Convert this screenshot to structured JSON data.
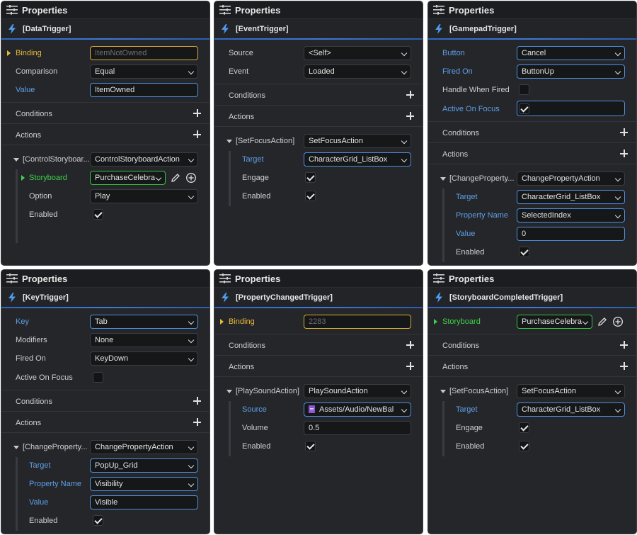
{
  "panel_title": "Properties",
  "panels": [
    {
      "header": "[DataTrigger]",
      "binding_label": "Binding",
      "binding_placeholder": "ItemNotOwned",
      "comparison_label": "Comparison",
      "comparison_value": "Equal",
      "value_label": "Value",
      "value_value": "ItemOwned",
      "conditions_label": "Conditions",
      "actions_label": "Actions",
      "action_name": "[ControlStoryboar...",
      "action_type": "ControlStoryboardAction",
      "storyboard_label": "Storyboard",
      "storyboard_value": "PurchaseCelebra",
      "option_label": "Option",
      "option_value": "Play",
      "enabled_label": "Enabled"
    },
    {
      "header": "[EventTrigger]",
      "source_label": "Source",
      "source_value": "<Self>",
      "event_label": "Event",
      "event_value": "Loaded",
      "conditions_label": "Conditions",
      "actions_label": "Actions",
      "action_name": "[SetFocusAction]",
      "action_type": "SetFocusAction",
      "target_label": "Target",
      "target_value": "CharacterGrid_ListBox",
      "engage_label": "Engage",
      "enabled_label": "Enabled"
    },
    {
      "header": "[GamepadTrigger]",
      "button_label": "Button",
      "button_value": "Cancel",
      "fired_on_label": "Fired On",
      "fired_on_value": "ButtonUp",
      "handle_label": "Handle When Fired",
      "focus_label": "Active On Focus",
      "conditions_label": "Conditions",
      "actions_label": "Actions",
      "action_name": "[ChangeProperty...",
      "action_type": "ChangePropertyAction",
      "target_label": "Target",
      "target_value": "CharacterGrid_ListBox",
      "property_label": "Property Name",
      "property_value": "SelectedIndex",
      "value_label": "Value",
      "value_value": "0",
      "enabled_label": "Enabled"
    },
    {
      "header": "[KeyTrigger]",
      "key_label": "Key",
      "key_value": "Tab",
      "modifiers_label": "Modifiers",
      "modifiers_value": "None",
      "fired_on_label": "Fired On",
      "fired_on_value": "KeyDown",
      "focus_label": "Active On Focus",
      "conditions_label": "Conditions",
      "actions_label": "Actions",
      "action_name": "[ChangeProperty...",
      "action_type": "ChangePropertyAction",
      "target_label": "Target",
      "target_value": "PopUp_Grid",
      "property_label": "Property Name",
      "property_value": "Visibility",
      "value_label": "Value",
      "value_value": "Visible",
      "enabled_label": "Enabled"
    },
    {
      "header": "[PropertyChangedTrigger]",
      "binding_label": "Binding",
      "binding_placeholder": "2283",
      "conditions_label": "Conditions",
      "actions_label": "Actions",
      "action_name": "[PlaySoundAction]",
      "action_type": "PlaySoundAction",
      "source_label": "Source",
      "source_value": "Assets/Audio/NewBal",
      "volume_label": "Volume",
      "volume_value": "0.5",
      "enabled_label": "Enabled"
    },
    {
      "header": "[StoryboardCompletedTrigger]",
      "storyboard_label": "Storyboard",
      "storyboard_value": "PurchaseCelebra",
      "conditions_label": "Conditions",
      "actions_label": "Actions",
      "action_name": "[SetFocusAction]",
      "action_type": "SetFocusAction",
      "target_label": "Target",
      "target_value": "CharacterGrid_ListBox",
      "engage_label": "Engage",
      "enabled_label": "Enabled"
    }
  ],
  "colors": {
    "panel_bg": "#25262a",
    "accent_blue": "#5e9fe6",
    "binding_yellow": "#e6b83a",
    "storyboard_green": "#3fd14a"
  },
  "icons": [
    "properties-icon",
    "lightning-icon",
    "plus-icon",
    "edit-pencil-icon",
    "add-circle-icon",
    "audio-file-icon",
    "chevron-down-icon",
    "checkmark-icon"
  ]
}
